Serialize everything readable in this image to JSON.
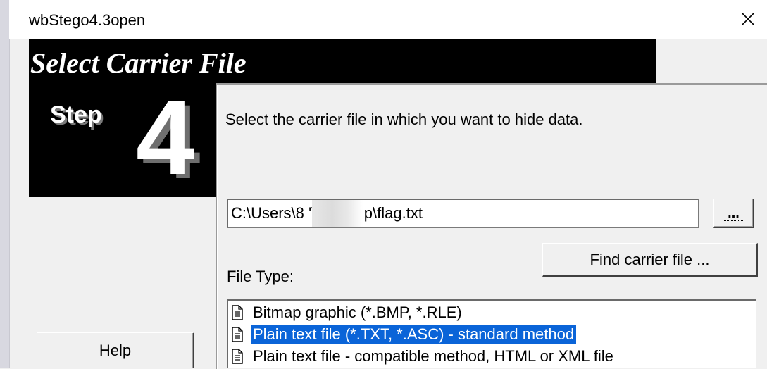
{
  "window": {
    "title": "wbStego4.3open",
    "close_icon": "close-icon"
  },
  "banner": {
    "title": "Select Carrier File",
    "step_label": "Step",
    "step_number": "4"
  },
  "main": {
    "instruction": "Select the carrier file in which you want to hide data.",
    "path_value": "C:\\Users\\8          '\\Desktop\\flag.txt",
    "browse_label": "...",
    "find_button": "Find carrier file ...",
    "filetype_label": "File Type:",
    "filetypes": [
      {
        "label": "Bitmap graphic (*.BMP, *.RLE)",
        "selected": false,
        "icon": "document-icon"
      },
      {
        "label": "Plain text file (*.TXT, *.ASC) - standard method",
        "selected": true,
        "icon": "document-icon"
      },
      {
        "label": "Plain text file - compatible method, HTML or XML file",
        "selected": false,
        "icon": "document-icon"
      }
    ]
  },
  "footer": {
    "help_label": "Help"
  },
  "colors": {
    "selection": "#0a64d8",
    "banner_bg": "#000000",
    "dialog_bg": "#f0f0f0"
  }
}
